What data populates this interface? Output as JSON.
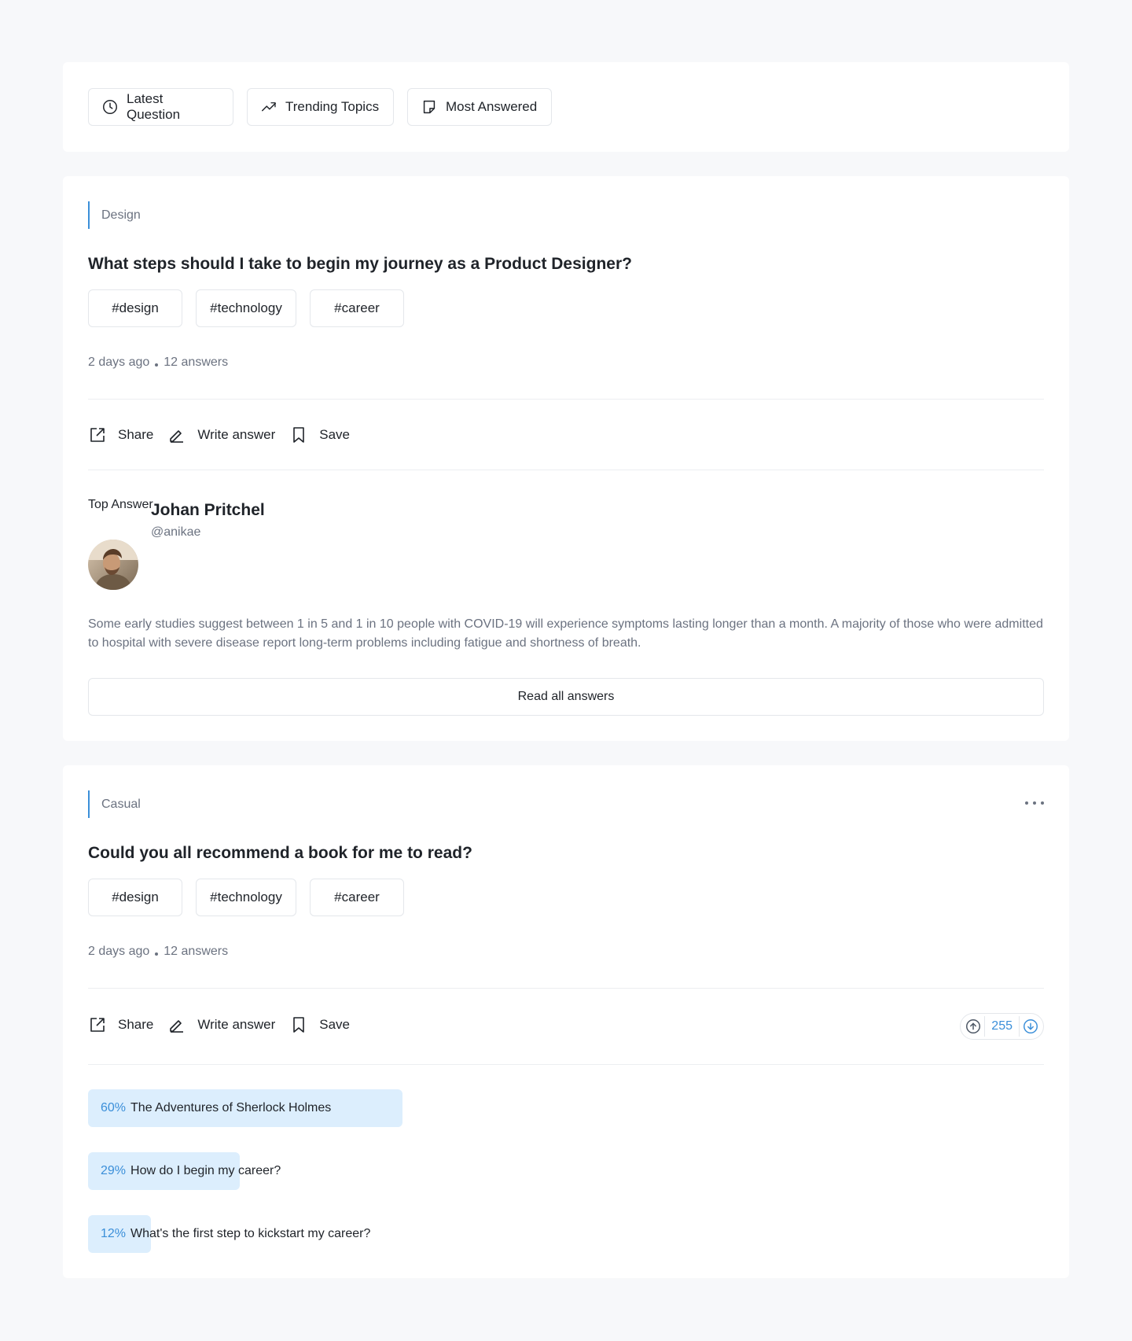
{
  "filters": [
    {
      "label": "Latest Question",
      "icon": "clock-icon"
    },
    {
      "label": "Trending Topics",
      "icon": "trending-icon"
    },
    {
      "label": "Most Answered",
      "icon": "note-icon"
    }
  ],
  "post1": {
    "category": "Design",
    "title": "What steps should I take to begin my journey as a Product Designer?",
    "tags": [
      "#design",
      "#technology",
      "#career"
    ],
    "time": "2 days ago",
    "answers": "12 answers",
    "actions": {
      "share": "Share",
      "write": "Write answer",
      "save": "Save"
    },
    "top_answer_label": "Top Answer",
    "author": {
      "name": "Johan Pritchel",
      "handle": "@anikae"
    },
    "answer_text": "Some early studies suggest between 1 in 5 and 1 in 10 people with COVID-19 will experience symptoms lasting longer than a month. A majority of those who were admitted to hospital with severe disease report long-term problems including fatigue and shortness of breath.",
    "read_all": "Read all answers"
  },
  "post2": {
    "category": "Casual",
    "title": "Could you all recommend a book for me to read?",
    "tags": [
      "#design",
      "#technology",
      "#career"
    ],
    "time": "2 days ago",
    "answers": "12 answers",
    "actions": {
      "share": "Share",
      "write": "Write answer",
      "save": "Save"
    },
    "votes": "255",
    "poll": [
      {
        "percent": "60%",
        "label": "The Adventures of Sherlock Holmes",
        "fraction": 0.6
      },
      {
        "percent": "29%",
        "label": "How do I begin my career?",
        "fraction": 0.29
      },
      {
        "percent": "12%",
        "label": "What's the first step to kickstart my career?",
        "fraction": 0.12
      }
    ]
  },
  "colors": {
    "accent": "#3b8fd9",
    "poll_fill": "#dceefd",
    "muted_text": "#6b7280"
  }
}
